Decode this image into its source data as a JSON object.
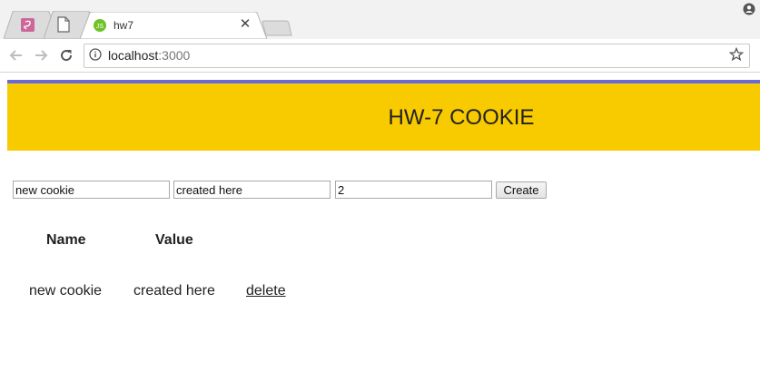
{
  "browser": {
    "tabs": [
      {
        "title": "",
        "icon": "sass-favicon-icon"
      },
      {
        "title": "",
        "icon": "document-icon"
      },
      {
        "title": "hw7",
        "icon": "nodejs-favicon-icon",
        "active": true
      }
    ],
    "close_symbol": "✕",
    "url": {
      "host": "localhost",
      "port": ":3000"
    }
  },
  "page": {
    "title": "HW-7 COOKIE",
    "form": {
      "name_value": "new cookie",
      "value_value": "created here",
      "expiry_value": "2",
      "create_label": "Create"
    },
    "table": {
      "headers": {
        "name": "Name",
        "value": "Value"
      },
      "rows": [
        {
          "name": "new cookie",
          "value": "created here",
          "action": "delete"
        }
      ]
    },
    "colors": {
      "banner": "#f8ca00",
      "banner_stripe": "#6b6bd6"
    }
  }
}
